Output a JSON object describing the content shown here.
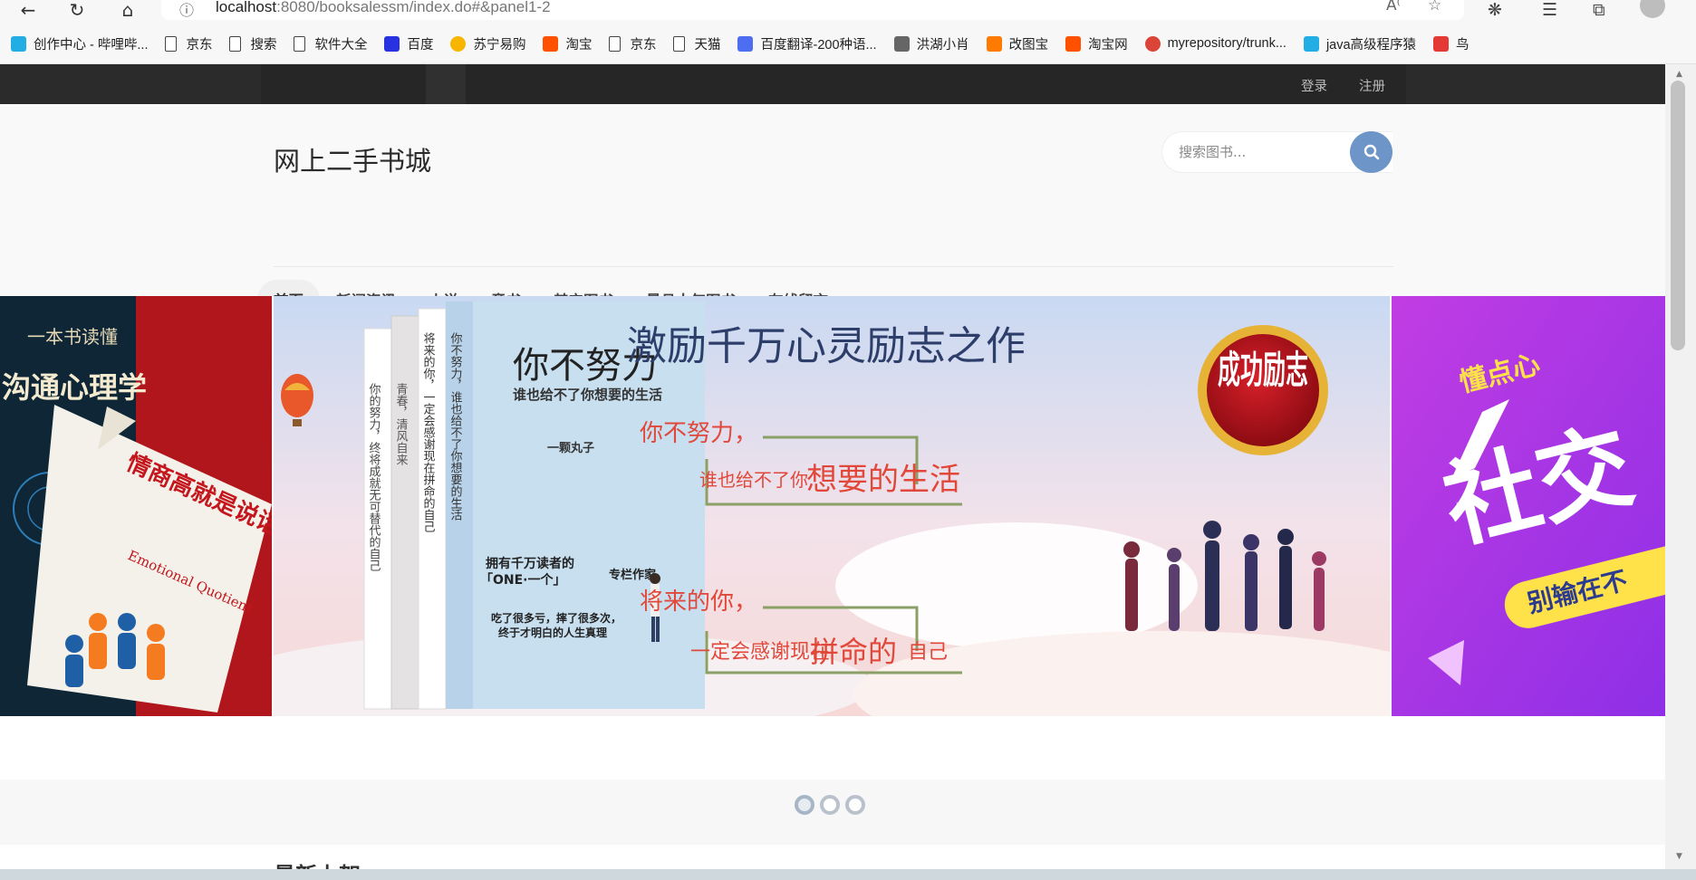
{
  "browser": {
    "url_host": "localhost",
    "url_rest": ":8080/booksalessm/index.do#&panel1-2",
    "bookmarks": [
      {
        "label": "创作中心 - 哔哩哔...",
        "icon": "bilibili-icon",
        "color": "#23ade5"
      },
      {
        "label": "京东",
        "icon": "page-icon"
      },
      {
        "label": "搜索",
        "icon": "page-icon"
      },
      {
        "label": "软件大全",
        "icon": "page-icon"
      },
      {
        "label": "百度",
        "icon": "baidu-paw-icon",
        "color": "#2932e1"
      },
      {
        "label": "苏宁易购",
        "icon": "suning-icon",
        "color": "#f7b500"
      },
      {
        "label": "淘宝",
        "icon": "taobao-icon",
        "color": "#ff5000"
      },
      {
        "label": "京东",
        "icon": "page-icon"
      },
      {
        "label": "天猫",
        "icon": "page-icon"
      },
      {
        "label": "百度翻译-200种语...",
        "icon": "translate-icon",
        "color": "#4e6ef2"
      },
      {
        "label": "洪湖小肖",
        "icon": "custom-icon",
        "color": "#666666"
      },
      {
        "label": "改图宝",
        "icon": "gaitubao-icon",
        "color": "#ff7a00"
      },
      {
        "label": "淘宝网",
        "icon": "taobao-icon",
        "color": "#ff5000"
      },
      {
        "label": "myrepository/trunk...",
        "icon": "chrome-icon",
        "color": "#db4437"
      },
      {
        "label": "java高级程序猿",
        "icon": "bilibili-icon",
        "color": "#23ade5"
      },
      {
        "label": "鸟",
        "icon": "bird-icon",
        "color": "#e53935"
      }
    ]
  },
  "topbar": {
    "login": "登录",
    "register": "注册"
  },
  "header": {
    "site_title": "网上二手书城",
    "search_placeholder": "搜索图书..."
  },
  "nav": [
    "首页",
    "新闻资讯",
    "小说",
    "童书",
    "其它图书",
    "最具人气图书",
    "在线留言"
  ],
  "nav_active_index": 0,
  "carousel": {
    "slide_left": {
      "top_text": "一本书读懂",
      "title": "沟通心理学",
      "book_title": "情商高就是说话让人舒服",
      "book_sub": "Emotional Quotient"
    },
    "slide_center": {
      "book_title": "你不努力",
      "book_subtitle": "谁也给不了你想要的生活",
      "author": "一颗丸子",
      "spine1": "你的努力，终将成就无可替代的自己",
      "spine2": "青春，清风自来",
      "spine3": "将来的你，一定会感谢现在拼命的自己",
      "spine4": "你不努力，谁也给不了你想要的生活",
      "headline": "激励千万心灵励志之作",
      "badge": "成功励志",
      "line1a": "你不努力，",
      "line1b": "谁也给不了你",
      "line1c": "想要的生活",
      "line2a": "将来的你，",
      "line2b": "一定会感谢现在",
      "line2c": "拼命的",
      "line2d": "自己",
      "promo1": "拥有千万读者的",
      "promo2": "「ONE·一个」",
      "promo3": "专栏作家",
      "promo4": "吃了很多亏，摔了很多次，",
      "promo5": "终于才明白的人生真理"
    },
    "slide_right": {
      "line1": "懂点心",
      "line2": "社交",
      "line3": "别输在不"
    },
    "dot_count": 3,
    "active_dot": 0
  },
  "section": {
    "heading": "最新上架"
  }
}
